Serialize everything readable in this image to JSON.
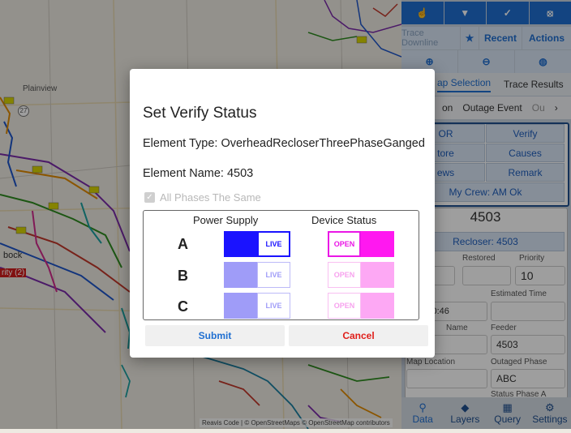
{
  "map": {
    "labels": [
      "Plainview",
      "bock",
      "rity (2)",
      "27"
    ],
    "attribution": "Reavis Code | © OpenStreetMaps © OpenStreetMap contributors"
  },
  "toolbar": {
    "row1_icons": [
      "pointer-icon",
      "wifi-icon",
      "check-icon",
      "satellite-icon"
    ],
    "trace_downline": "Trace Downline",
    "recent": "Recent",
    "actions": "Actions",
    "row3_icons": [
      "zoom-in-icon",
      "zoom-out-icon",
      "globe-icon"
    ]
  },
  "panel": {
    "tabs": [
      "ap Selection",
      "Trace Results"
    ],
    "subtabs": [
      "on",
      "Outage Event",
      "Ou"
    ],
    "grid_buttons": [
      "OR",
      "Verify",
      "tore",
      "Causes",
      "ews",
      "Remark"
    ],
    "crew": "My Crew: AM Ok",
    "element_id": "4503",
    "element_type_label": "Recloser: 4503",
    "labels": {
      "restored": "Restored",
      "priority": "Priority",
      "estimated_time": "Estimated Time",
      "name": "Name",
      "feeder": "Feeder",
      "map_location": "Map Location",
      "outaged_phase": "Outaged Phase",
      "status_phase_a": "Status Phase A"
    },
    "values": {
      "priority": "10",
      "date_fragment": "21, 10:46",
      "feeder": "4503",
      "outaged_phase": "ABC"
    }
  },
  "bottom_nav": [
    {
      "label": "Data",
      "icon": "search-icon"
    },
    {
      "label": "Layers",
      "icon": "layers-icon"
    },
    {
      "label": "Query",
      "icon": "table-icon"
    },
    {
      "label": "Settings",
      "icon": "settings-icon"
    }
  ],
  "modal": {
    "title": "Set Verify Status",
    "element_type": "Element Type: OverheadRecloserThreePhaseGanged",
    "element_name": "Element Name: 4503",
    "all_phases_same": "All Phases The Same",
    "col_power": "Power Supply",
    "col_device": "Device Status",
    "phases": [
      {
        "name": "A",
        "power": "LIVE",
        "device": "OPEN",
        "enabled": true
      },
      {
        "name": "B",
        "power": "LIVE",
        "device": "OPEN",
        "enabled": false
      },
      {
        "name": "C",
        "power": "LIVE",
        "device": "OPEN",
        "enabled": false
      }
    ],
    "submit": "Submit",
    "cancel": "Cancel"
  },
  "colors": {
    "accent": "#1f6fd1",
    "power_live": "#1a13ff",
    "device_open": "#ff18f0",
    "cancel_text": "#e0201b",
    "submit_text": "#1f6fd1"
  }
}
